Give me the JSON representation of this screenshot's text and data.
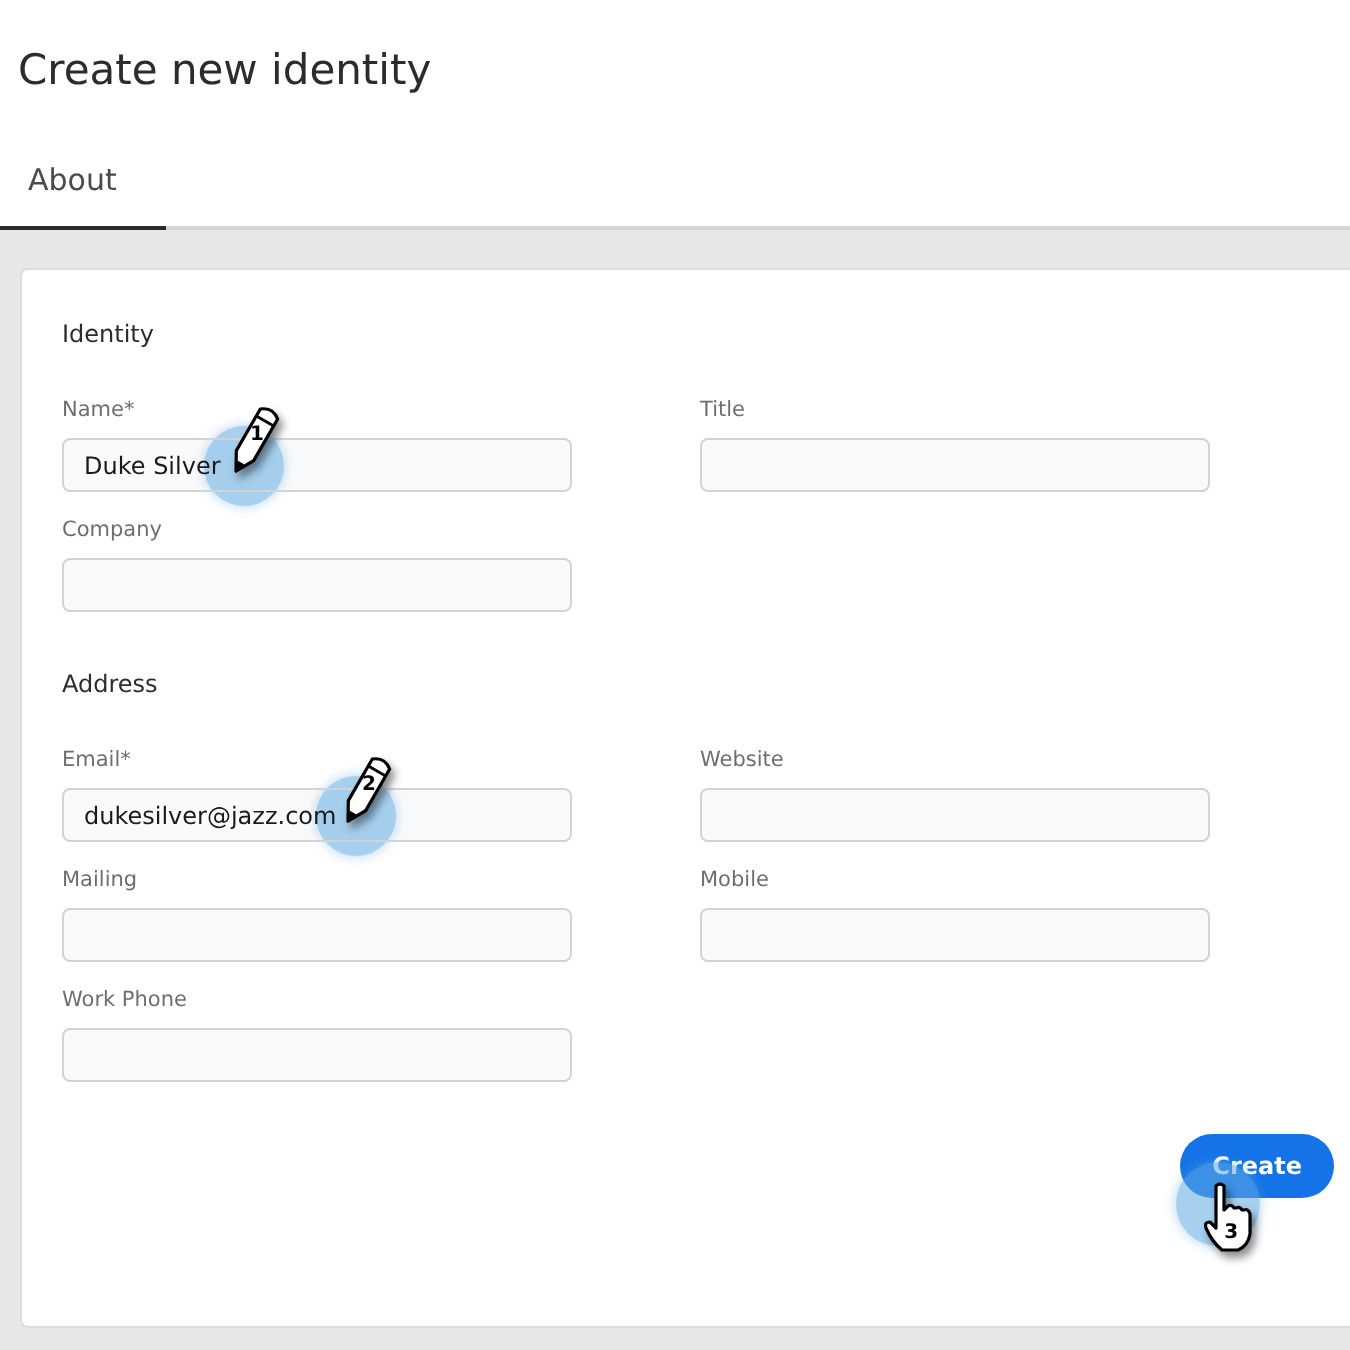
{
  "page": {
    "title": "Create new identity"
  },
  "tabs": [
    {
      "label": "About",
      "selected": true
    }
  ],
  "sections": [
    {
      "heading": "Identity",
      "left": [
        {
          "label": "Name*",
          "value": "Duke Silver",
          "step": "1"
        },
        {
          "label": "Company"
        }
      ],
      "right": [
        {
          "label": "Title"
        }
      ]
    },
    {
      "heading": "Address",
      "left": [
        {
          "label": "Email*",
          "value": "dukesilver@jazz.com",
          "step": "2"
        },
        {
          "label": "Mailing"
        },
        {
          "label": "Work Phone"
        }
      ],
      "right": [
        {
          "label": "Website"
        },
        {
          "label": "Mobile"
        }
      ]
    }
  ],
  "create_button": {
    "label": "Create",
    "step": "3"
  }
}
